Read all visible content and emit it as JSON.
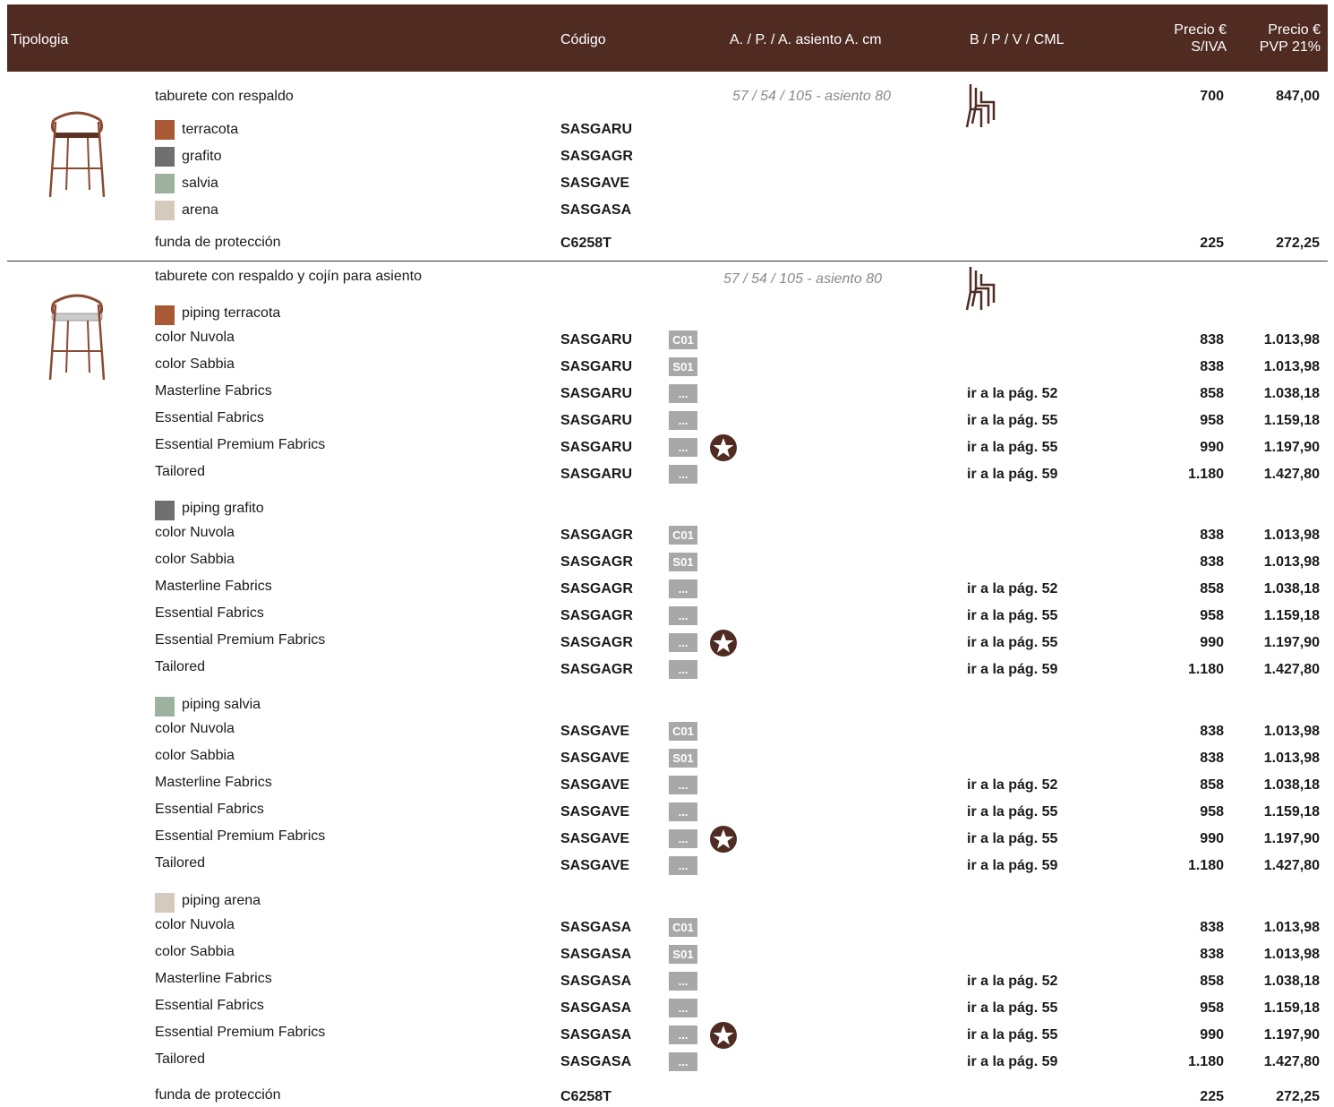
{
  "header": {
    "tipologia": "Tipologia",
    "codigo": "Código",
    "dimensiones": "A. / P. / A. asiento A. cm",
    "bpv": "B / P / V / CML",
    "precio_siva_line1": "Precio €",
    "precio_siva_line2": "S/IVA",
    "precio_pvp_line1": "Precio €",
    "precio_pvp_line2": "PVP 21%"
  },
  "colors": {
    "header_bg": "#4f2b22",
    "terracota": "#a95a35",
    "grafito": "#6f6f6f",
    "salvia": "#9cb29e",
    "arena": "#d6cabd",
    "badge": "#a8a8a8",
    "star": "#4f2b22"
  },
  "product1": {
    "title": "taburete con respaldo",
    "dims": "57 / 54 / 105 - asiento 80",
    "stack_icon": "stack-chair-icon",
    "price_siva": "700",
    "price_pvp": "847,00",
    "variants": [
      {
        "label": "terracota",
        "code": "SASGARU",
        "color": "#a95a35"
      },
      {
        "label": "grafito",
        "code": "SASGAGR",
        "color": "#6f6f6f"
      },
      {
        "label": "salvia",
        "code": "SASGAVE",
        "color": "#9cb29e"
      },
      {
        "label": "arena",
        "code": "SASGASA",
        "color": "#d6cabd"
      }
    ],
    "cover": {
      "label": "funda de protección",
      "code": "C6258T",
      "price_siva": "225",
      "price_pvp": "272,25"
    }
  },
  "product2": {
    "title": "taburete con respaldo y cojín para asiento",
    "dims": "57 / 54 / 105 - asiento 80",
    "stack_icon": "stack-chair-icon",
    "groups": [
      {
        "label": "piping terracota",
        "color": "#a95a35",
        "code": "SASGARU",
        "rows": [
          {
            "label": "color Nuvola",
            "badge": "C01",
            "star": false,
            "ref": "",
            "price_siva": "838",
            "price_pvp": "1.013,98"
          },
          {
            "label": "color Sabbia",
            "badge": "S01",
            "star": false,
            "ref": "",
            "price_siva": "838",
            "price_pvp": "1.013,98"
          },
          {
            "label": "Masterline Fabrics",
            "badge": "...",
            "star": false,
            "ref": "ir a la pág. 52",
            "price_siva": "858",
            "price_pvp": "1.038,18"
          },
          {
            "label": "Essential Fabrics",
            "badge": "...",
            "star": false,
            "ref": "ir a la pág. 55",
            "price_siva": "958",
            "price_pvp": "1.159,18"
          },
          {
            "label": "Essential Premium Fabrics",
            "badge": "...",
            "star": true,
            "ref": "ir a la pág. 55",
            "price_siva": "990",
            "price_pvp": "1.197,90"
          },
          {
            "label": "Tailored",
            "badge": "...",
            "star": false,
            "ref": "ir a la pág. 59",
            "price_siva": "1.180",
            "price_pvp": "1.427,80"
          }
        ]
      },
      {
        "label": "piping grafito",
        "color": "#6f6f6f",
        "code": "SASGAGR",
        "rows": [
          {
            "label": "color Nuvola",
            "badge": "C01",
            "star": false,
            "ref": "",
            "price_siva": "838",
            "price_pvp": "1.013,98"
          },
          {
            "label": "color Sabbia",
            "badge": "S01",
            "star": false,
            "ref": "",
            "price_siva": "838",
            "price_pvp": "1.013,98"
          },
          {
            "label": "Masterline Fabrics",
            "badge": "...",
            "star": false,
            "ref": "ir a la pág. 52",
            "price_siva": "858",
            "price_pvp": "1.038,18"
          },
          {
            "label": "Essential Fabrics",
            "badge": "...",
            "star": false,
            "ref": "ir a la pág. 55",
            "price_siva": "958",
            "price_pvp": "1.159,18"
          },
          {
            "label": "Essential Premium Fabrics",
            "badge": "...",
            "star": true,
            "ref": "ir a la pág. 55",
            "price_siva": "990",
            "price_pvp": "1.197,90"
          },
          {
            "label": "Tailored",
            "badge": "...",
            "star": false,
            "ref": "ir a la pág. 59",
            "price_siva": "1.180",
            "price_pvp": "1.427,80"
          }
        ]
      },
      {
        "label": "piping salvia",
        "color": "#9cb29e",
        "code": "SASGAVE",
        "rows": [
          {
            "label": "color Nuvola",
            "badge": "C01",
            "star": false,
            "ref": "",
            "price_siva": "838",
            "price_pvp": "1.013,98"
          },
          {
            "label": "color Sabbia",
            "badge": "S01",
            "star": false,
            "ref": "",
            "price_siva": "838",
            "price_pvp": "1.013,98"
          },
          {
            "label": "Masterline Fabrics",
            "badge": "...",
            "star": false,
            "ref": "ir a la pág. 52",
            "price_siva": "858",
            "price_pvp": "1.038,18"
          },
          {
            "label": "Essential Fabrics",
            "badge": "...",
            "star": false,
            "ref": "ir a la pág. 55",
            "price_siva": "958",
            "price_pvp": "1.159,18"
          },
          {
            "label": "Essential Premium Fabrics",
            "badge": "...",
            "star": true,
            "ref": "ir a la pág. 55",
            "price_siva": "990",
            "price_pvp": "1.197,90"
          },
          {
            "label": "Tailored",
            "badge": "...",
            "star": false,
            "ref": "ir a la pág. 59",
            "price_siva": "1.180",
            "price_pvp": "1.427,80"
          }
        ]
      },
      {
        "label": "piping arena",
        "color": "#d6cabd",
        "code": "SASGASA",
        "rows": [
          {
            "label": "color Nuvola",
            "badge": "C01",
            "star": false,
            "ref": "",
            "price_siva": "838",
            "price_pvp": "1.013,98"
          },
          {
            "label": "color Sabbia",
            "badge": "S01",
            "star": false,
            "ref": "",
            "price_siva": "838",
            "price_pvp": "1.013,98"
          },
          {
            "label": "Masterline Fabrics",
            "badge": "...",
            "star": false,
            "ref": "ir a la pág. 52",
            "price_siva": "858",
            "price_pvp": "1.038,18"
          },
          {
            "label": "Essential Fabrics",
            "badge": "...",
            "star": false,
            "ref": "ir a la pág. 55",
            "price_siva": "958",
            "price_pvp": "1.159,18"
          },
          {
            "label": "Essential Premium Fabrics",
            "badge": "...",
            "star": true,
            "ref": "ir a la pág. 55",
            "price_siva": "990",
            "price_pvp": "1.197,90"
          },
          {
            "label": "Tailored",
            "badge": "...",
            "star": false,
            "ref": "ir a la pág. 59",
            "price_siva": "1.180",
            "price_pvp": "1.427,80"
          }
        ]
      }
    ],
    "cover": {
      "label": "funda de protección",
      "code": "C6258T",
      "price_siva": "225",
      "price_pvp": "272,25"
    }
  }
}
